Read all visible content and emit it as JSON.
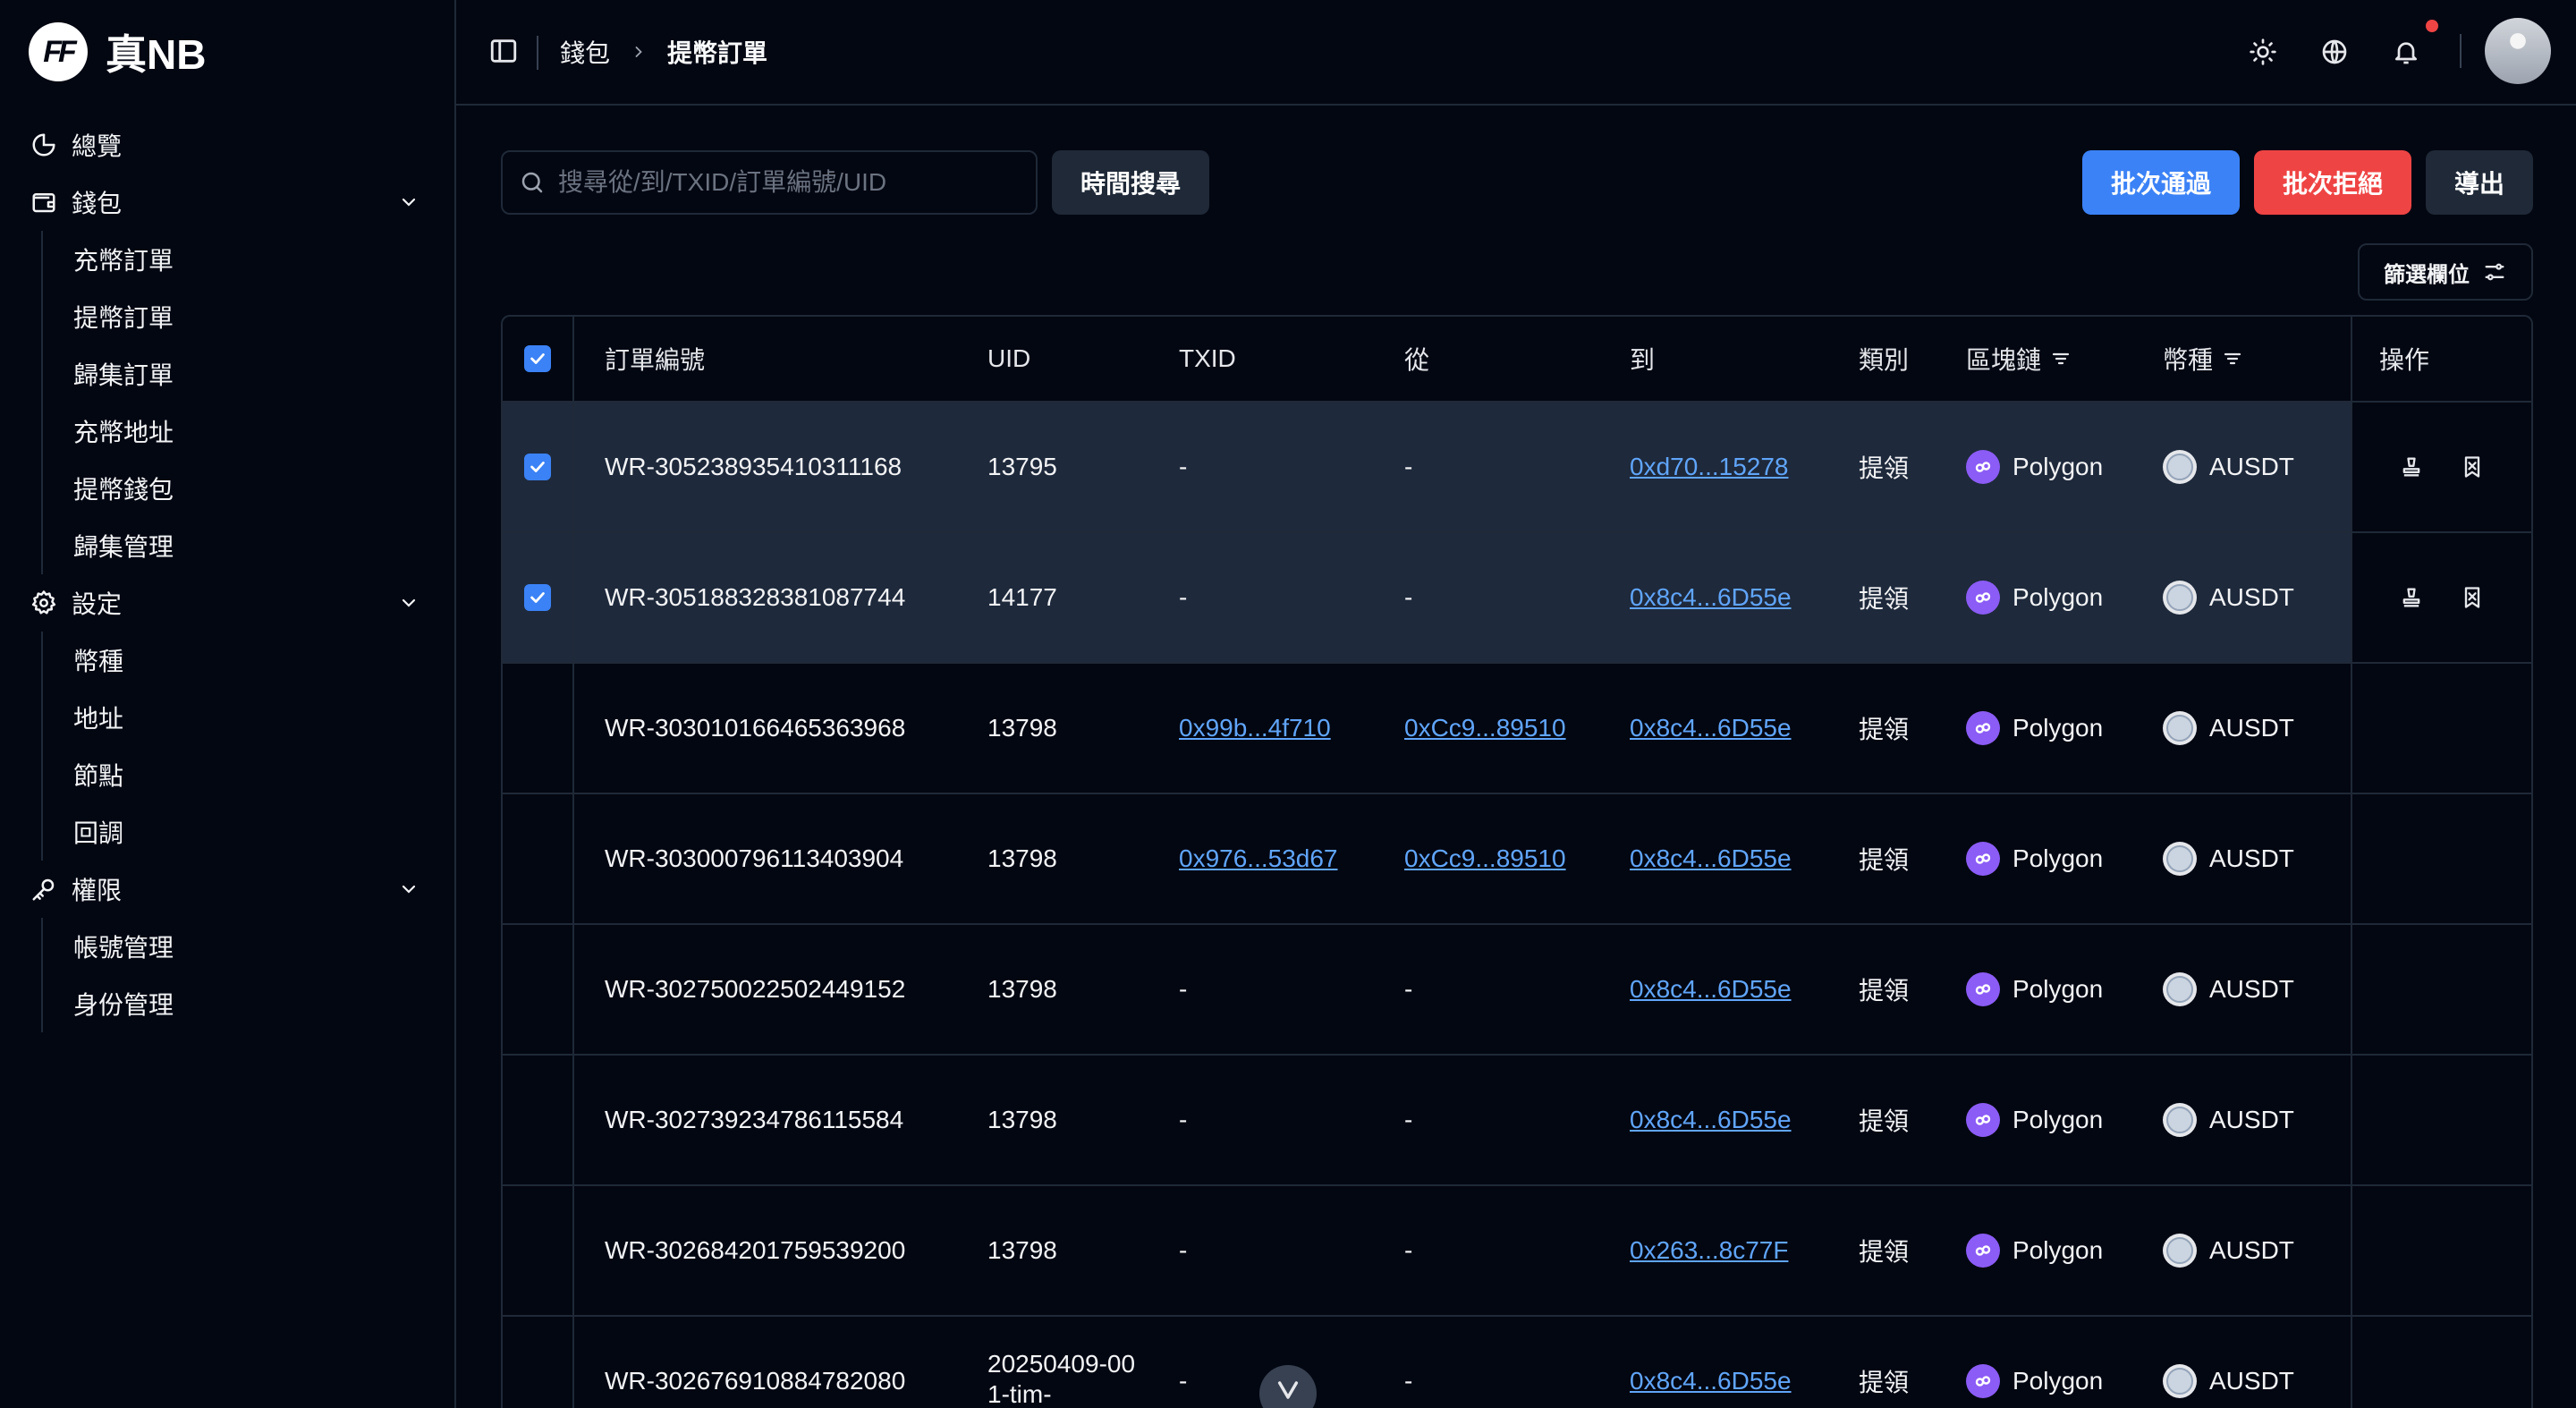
{
  "brand": {
    "logo_text": "FF",
    "name": "真NB"
  },
  "sidebar": {
    "overview": "總覽",
    "wallet": {
      "label": "錢包",
      "items": [
        "充幣訂單",
        "提幣訂單",
        "歸集訂單",
        "充幣地址",
        "提幣錢包",
        "歸集管理"
      ]
    },
    "settings": {
      "label": "設定",
      "items": [
        "幣種",
        "地址",
        "節點",
        "回調"
      ]
    },
    "permissions": {
      "label": "權限",
      "items": [
        "帳號管理",
        "身份管理"
      ]
    }
  },
  "breadcrumb": {
    "parent": "錢包",
    "current": "提幣訂單"
  },
  "toolbar": {
    "search_placeholder": "搜尋從/到/TXID/訂單編號/UID",
    "time_search": "時間搜尋",
    "batch_pass": "批次通過",
    "batch_reject": "批次拒絕",
    "export": "導出",
    "filter_columns": "篩選欄位"
  },
  "table": {
    "headers": {
      "order": "訂單編號",
      "uid": "UID",
      "txid": "TXID",
      "from": "從",
      "to": "到",
      "type": "類別",
      "chain": "區塊鏈",
      "coin": "幣種",
      "ops": "操作"
    },
    "rows": [
      {
        "selected": true,
        "order": "WR-305238935410311168",
        "uid": "13795",
        "txid": "-",
        "from": "-",
        "to": "0xd70...15278",
        "type": "提領",
        "chain": "Polygon",
        "coin": "AUSDT"
      },
      {
        "selected": true,
        "order": "WR-305188328381087744",
        "uid": "14177",
        "txid": "-",
        "from": "-",
        "to": "0x8c4...6D55e",
        "type": "提領",
        "chain": "Polygon",
        "coin": "AUSDT"
      },
      {
        "selected": false,
        "order": "WR-303010166465363968",
        "uid": "13798",
        "txid": "0x99b...4f710",
        "from": "0xCc9...89510",
        "to": "0x8c4...6D55e",
        "type": "提領",
        "chain": "Polygon",
        "coin": "AUSDT"
      },
      {
        "selected": false,
        "order": "WR-303000796113403904",
        "uid": "13798",
        "txid": "0x976...53d67",
        "from": "0xCc9...89510",
        "to": "0x8c4...6D55e",
        "type": "提領",
        "chain": "Polygon",
        "coin": "AUSDT"
      },
      {
        "selected": false,
        "order": "WR-302750022502449152",
        "uid": "13798",
        "txid": "-",
        "from": "-",
        "to": "0x8c4...6D55e",
        "type": "提領",
        "chain": "Polygon",
        "coin": "AUSDT"
      },
      {
        "selected": false,
        "order": "WR-302739234786115584",
        "uid": "13798",
        "txid": "-",
        "from": "-",
        "to": "0x8c4...6D55e",
        "type": "提領",
        "chain": "Polygon",
        "coin": "AUSDT"
      },
      {
        "selected": false,
        "order": "WR-302684201759539200",
        "uid": "13798",
        "txid": "-",
        "from": "-",
        "to": "0x263...8c77F",
        "type": "提領",
        "chain": "Polygon",
        "coin": "AUSDT"
      },
      {
        "selected": false,
        "order": "WR-302676910884782080",
        "uid": "20250409-001-tim-",
        "txid": "-",
        "from": "-",
        "to": "0x8c4...6D55e",
        "type": "提領",
        "chain": "Polygon",
        "coin": "AUSDT"
      }
    ]
  }
}
